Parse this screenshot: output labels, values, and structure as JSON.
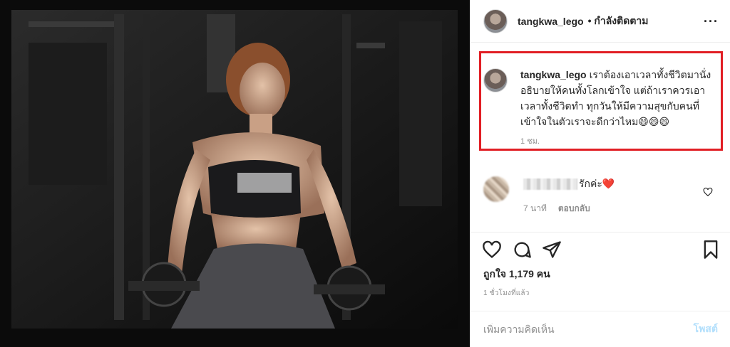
{
  "post": {
    "username": "tangkwa_lego",
    "follow_status": "• กำลังติดตาม",
    "more_icon": "more-horizontal-icon"
  },
  "caption": {
    "username": "tangkwa_lego",
    "text": "เราต้องเอาเวลาทั้งชีวิตมานั่งอธิบายให้คนทั้งโลกเข้าใจ แต่ถ้าเราควรเอาเวลาทั้งชีวิตทำ ทุกวันให้มีความสุขกับคนที่เข้าใจในตัวเราจะดีกว่าไหม😄😄😄",
    "time": "1 ชม."
  },
  "comment": {
    "text": "รักค่ะ❤️",
    "time": "7 นาที",
    "reply_label": "ตอบกลับ"
  },
  "actions": {
    "like_icon": "heart-outline-icon",
    "comment_icon": "comment-bubble-icon",
    "share_icon": "send-paper-plane-icon",
    "save_icon": "bookmark-icon"
  },
  "likes": "ถูกใจ 1,179 คน",
  "post_time": "1 ชั่วโมงที่แล้ว",
  "add_comment": {
    "placeholder": "เพิ่มความคิดเห็น",
    "post_label": "โพสต์"
  },
  "colors": {
    "highlight_border": "#e11e24",
    "post_button_disabled": "#b2dffc",
    "secondary_text": "#8e8e8e"
  }
}
